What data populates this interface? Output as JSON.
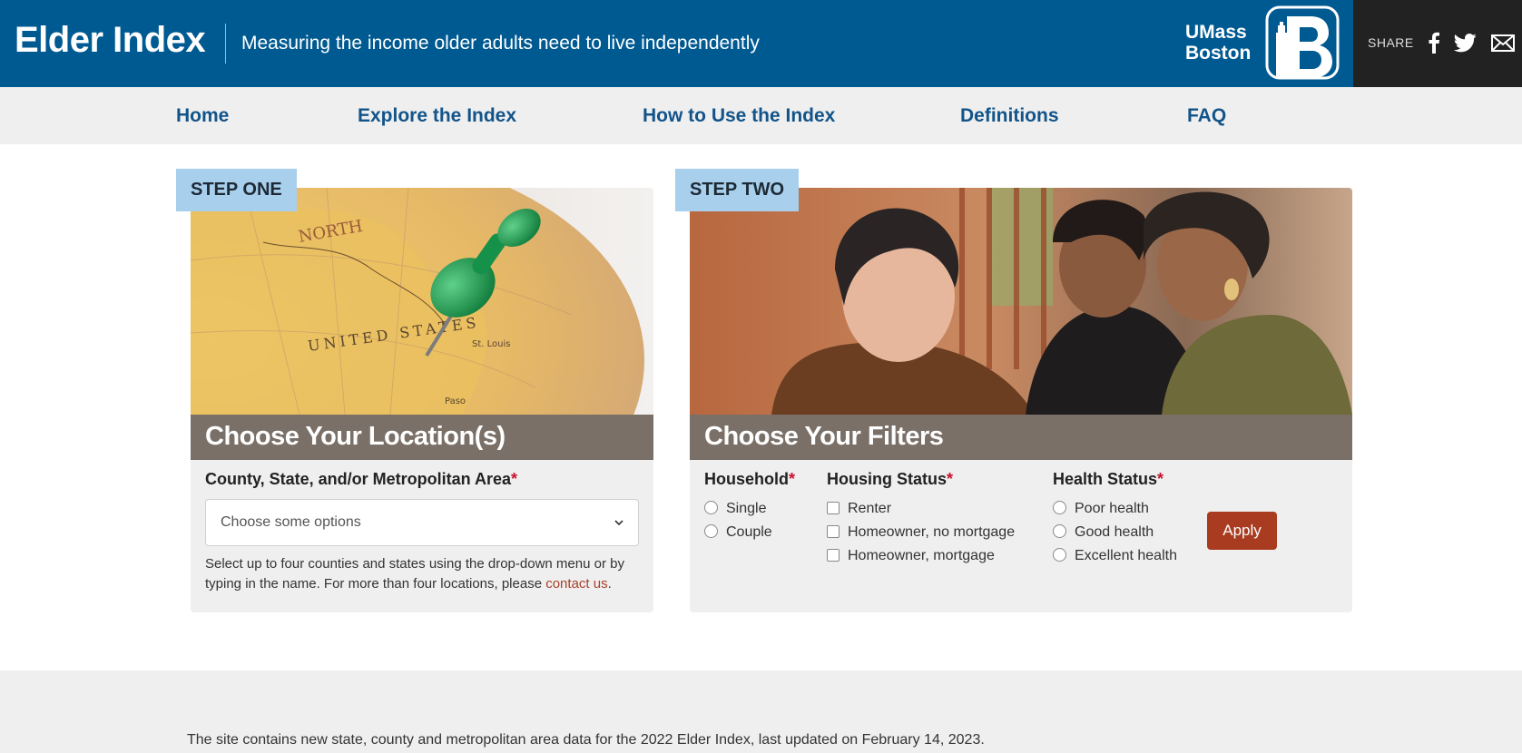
{
  "header": {
    "brand": "Elder Index",
    "tagline": "Measuring the income older adults need to live independently",
    "university_line1": "UMass",
    "university_line2": "Boston",
    "logo_icon": "umass-boston-lighthouse-b-logo",
    "share_label": "SHARE",
    "share_icons": [
      "facebook-icon",
      "twitter-icon",
      "email-icon"
    ]
  },
  "nav": {
    "items": [
      "Home",
      "Explore the Index",
      "How to Use the Index",
      "Definitions",
      "FAQ"
    ]
  },
  "step_one": {
    "tag": "STEP ONE",
    "title": "Choose Your Location(s)",
    "field_label": "County, State, and/or Metropolitan Area",
    "required_marker": "*",
    "placeholder": "Choose some options",
    "helper_text": "Select up to four counties and states using the drop-down menu or by typing in the name. For more than four locations, please ",
    "helper_link": "contact us",
    "helper_end": ".",
    "map_labels": [
      "UNITED STATES",
      "NORTH",
      "St. Louis",
      "Paso"
    ]
  },
  "step_two": {
    "tag": "STEP TWO",
    "title": "Choose Your Filters",
    "household": {
      "label": "Household",
      "options": [
        "Single",
        "Couple"
      ]
    },
    "housing": {
      "label": "Housing Status",
      "options": [
        "Renter",
        "Homeowner, no mortgage",
        "Homeowner, mortgage"
      ]
    },
    "health": {
      "label": "Health Status",
      "options": [
        "Poor health",
        "Good health",
        "Excellent health"
      ]
    },
    "required_marker": "*",
    "apply_label": "Apply"
  },
  "footer": {
    "text": "The site contains new state, county and metropolitan area data for the 2022 Elder Index, last updated on February 14, 2023."
  },
  "colors": {
    "header_blue": "#005a92",
    "nav_link": "#12548a",
    "band": "#7a7068",
    "tag_blue": "#a8cfec",
    "apply_red": "#a83b20",
    "required_red": "#c8102e"
  }
}
